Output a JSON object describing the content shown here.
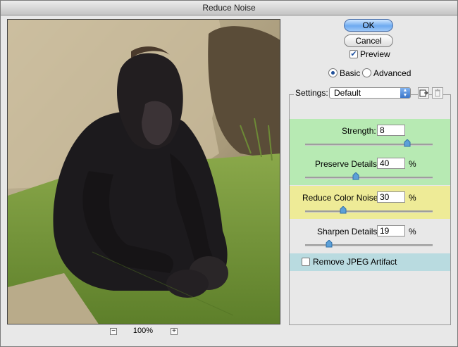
{
  "window": {
    "title": "Reduce Noise"
  },
  "zoom": {
    "minus": "−",
    "plus": "+",
    "level": "100%"
  },
  "buttons": {
    "ok": "OK",
    "cancel": "Cancel"
  },
  "preview": {
    "label": "Preview",
    "checked": true
  },
  "mode": {
    "basic": "Basic",
    "advanced": "Advanced",
    "selected": "Basic"
  },
  "settings": {
    "label": "Settings:",
    "value": "Default"
  },
  "sliders": [
    {
      "label": "Strength:",
      "value": "8",
      "unit": "",
      "fraction": 0.8
    },
    {
      "label": "Preserve Details:",
      "value": "40",
      "unit": "%",
      "fraction": 0.4
    },
    {
      "label": "Reduce Color Noise:",
      "value": "30",
      "unit": "%",
      "fraction": 0.3
    },
    {
      "label": "Sharpen Details:",
      "value": "19",
      "unit": "%",
      "fraction": 0.19
    }
  ],
  "jpeg": {
    "label": "Remove JPEG Artifact",
    "checked": false
  },
  "colors": {
    "green_band": "#b7eab3",
    "yellow_band": "#eeeb97",
    "blue_band": "#b9dbe0",
    "ok_button": "#6eaaf0"
  }
}
